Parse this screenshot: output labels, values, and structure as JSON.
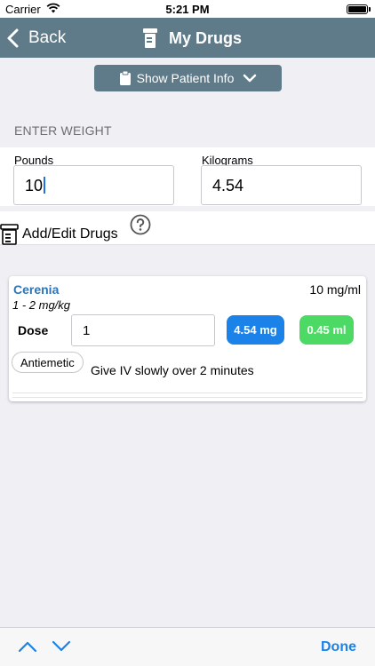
{
  "status_bar": {
    "carrier": "Carrier",
    "time": "5:21 PM"
  },
  "nav": {
    "back_label": "Back",
    "title": "My Drugs",
    "title_icon": "pill-bottle-icon",
    "color": "#5f7a88"
  },
  "patient_button": {
    "label": "Show Patient Info",
    "icon": "clipboard-icon"
  },
  "weight": {
    "section_header": "ENTER WEIGHT",
    "pounds_label": "Pounds",
    "pounds_value": "10",
    "kilograms_label": "Kilograms",
    "kilograms_value": "4.54"
  },
  "drugs_header": {
    "label": "Add/Edit Drugs",
    "icon": "pill-bottle-icon",
    "help_icon": "question-circle-icon"
  },
  "drug": {
    "name": "Cerenia",
    "concentration": "10 mg/ml",
    "dose_range": "1 - 2 mg/kg",
    "dose_label": "Dose",
    "dose_value": "1",
    "result_mg": "4.54 mg",
    "result_ml": "0.45 ml",
    "category": "Antiemetic",
    "note": "Give IV slowly over 2 minutes",
    "mg_color": "#1a82e8",
    "ml_color": "#4cd964"
  },
  "toolbar": {
    "done_label": "Done",
    "accent": "#1a82e8"
  }
}
